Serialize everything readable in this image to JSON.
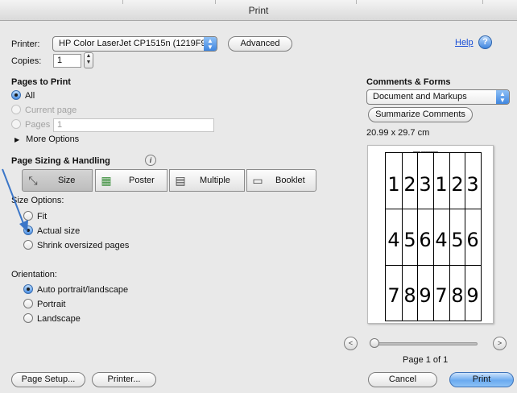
{
  "window": {
    "title": "Print"
  },
  "printer": {
    "label": "Printer:",
    "value": "HP Color LaserJet CP1515n (1219F9)",
    "advanced_label": "Advanced"
  },
  "copies": {
    "label": "Copies:",
    "value": "1"
  },
  "help_label": "Help",
  "pages_to_print": {
    "title": "Pages to Print",
    "options": [
      {
        "label": "All",
        "checked": true
      },
      {
        "label": "Current page",
        "checked": false
      },
      {
        "label": "Pages",
        "checked": false
      }
    ],
    "pages_value": "1",
    "more_options_label": "More Options"
  },
  "sizing": {
    "title": "Page Sizing & Handling",
    "buttons": [
      {
        "label": "Size",
        "icon": "size-icon",
        "selected": true
      },
      {
        "label": "Poster",
        "icon": "poster-icon",
        "selected": false
      },
      {
        "label": "Multiple",
        "icon": "multiple-icon",
        "selected": false
      },
      {
        "label": "Booklet",
        "icon": "booklet-icon",
        "selected": false
      }
    ],
    "size_options_label": "Size Options:",
    "size_options": [
      {
        "label": "Fit",
        "checked": false
      },
      {
        "label": "Actual size",
        "checked": true
      },
      {
        "label": "Shrink oversized pages",
        "checked": false
      }
    ]
  },
  "orientation": {
    "label": "Orientation:",
    "options": [
      {
        "label": "Auto portrait/landscape",
        "checked": true
      },
      {
        "label": "Portrait",
        "checked": false
      },
      {
        "label": "Landscape",
        "checked": false
      }
    ]
  },
  "comments": {
    "title": "Comments & Forms",
    "selected": "Document and Markups",
    "summarize_label": "Summarize Comments"
  },
  "preview": {
    "page_size": "20.99 x 29.7 cm",
    "rows": [
      [
        "1",
        "2",
        "3",
        "1",
        "2",
        "3"
      ],
      [
        "4",
        "5",
        "6",
        "4",
        "5",
        "6"
      ],
      [
        "7",
        "8",
        "9",
        "7",
        "8",
        "9"
      ]
    ],
    "page_indicator": "Page 1 of 1",
    "slider_position": 0
  },
  "buttons": {
    "page_setup": "Page Setup...",
    "printer": "Printer...",
    "cancel": "Cancel",
    "print": "Print"
  },
  "colors": {
    "accent": "#4b8fe3",
    "annotation_arrow": "#3b76c8",
    "link": "#1a4fd6"
  }
}
